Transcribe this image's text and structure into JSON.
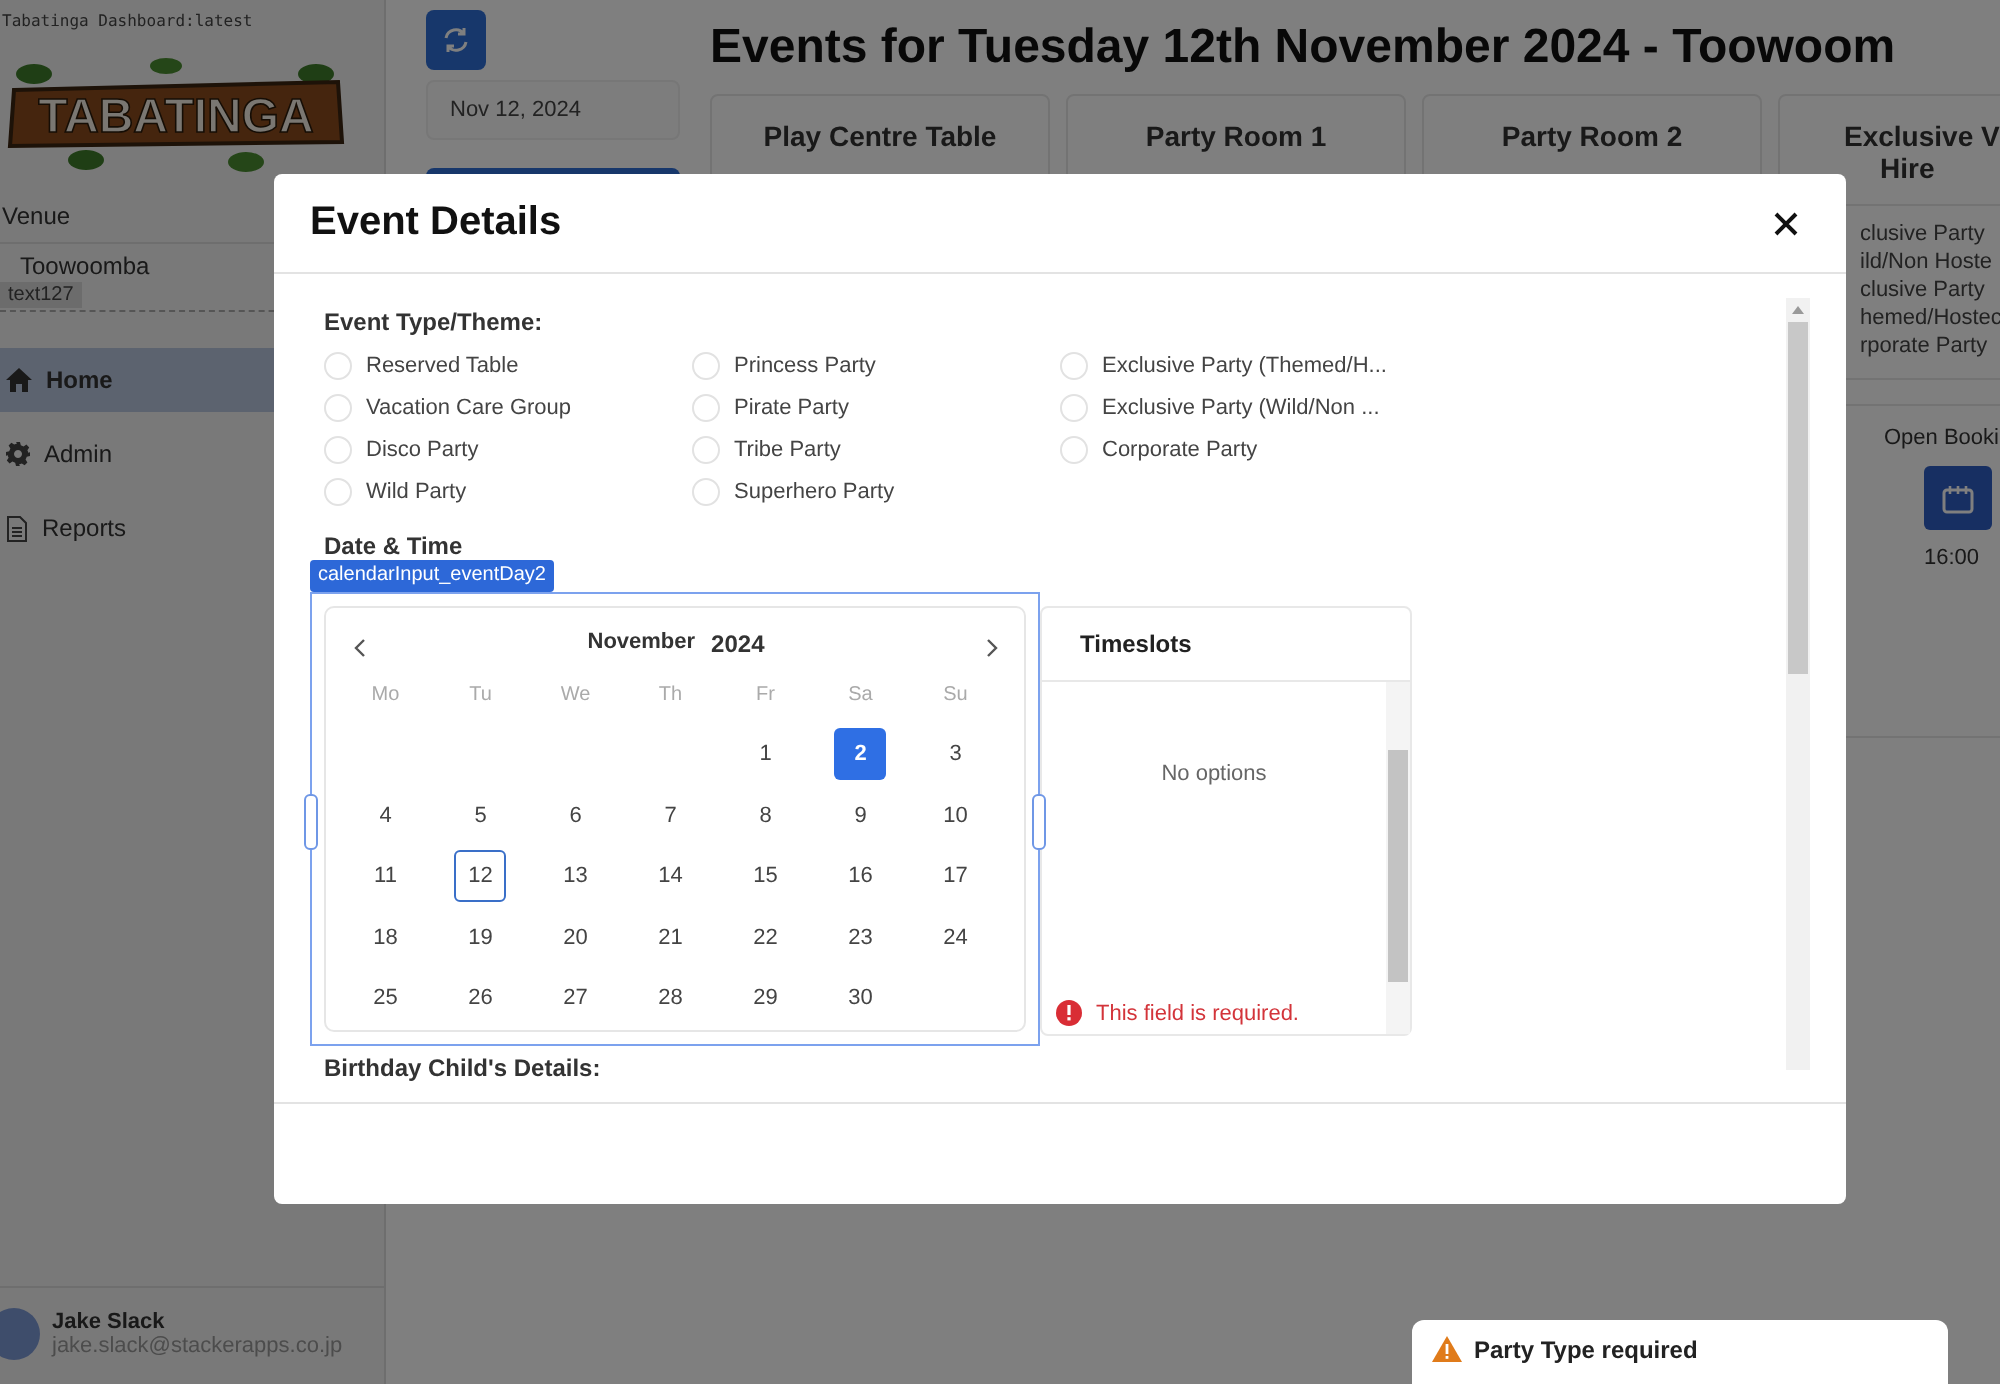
{
  "build_label": "Tabatinga Dashboard:latest",
  "sidebar": {
    "logo_text": "TABATINGA",
    "venue_label": "Venue",
    "venue_value": "Toowoomba",
    "debug_tag": "text127",
    "nav": [
      {
        "label": "Home",
        "kind": "home",
        "selected": true
      },
      {
        "label": "Admin",
        "kind": "gear",
        "selected": false
      },
      {
        "label": "Reports",
        "kind": "document",
        "selected": false
      }
    ],
    "user": {
      "name": "Jake Slack",
      "email": "jake.slack@stackerapps.co.jp"
    }
  },
  "toolbar": {
    "date": "Nov 12, 2024"
  },
  "page_title": "Events for Tuesday 12th November 2024 - Toowoom",
  "columns": [
    {
      "title_lines": [
        "Play Centre Table"
      ]
    },
    {
      "title_lines": [
        "Party Room 1"
      ]
    },
    {
      "title_lines": [
        "Party Room 2"
      ]
    },
    {
      "title_lines": [
        "Exclusive V",
        "Hire"
      ],
      "items": [
        "clusive Party",
        "ild/Non Hoste",
        "clusive Party",
        "hemed/Hostec",
        "rporate Party"
      ],
      "open_label": "Open Booki",
      "time": "16:00"
    }
  ],
  "modal": {
    "title": "Event Details",
    "event_type": {
      "label": "Event Type/Theme:",
      "options": [
        {
          "label": "Reserved Table",
          "selected": false
        },
        {
          "label": "Vacation Care Group",
          "selected": false
        },
        {
          "label": "Disco Party",
          "selected": false
        },
        {
          "label": "Wild Party",
          "selected": false
        },
        {
          "label": "Princess Party",
          "selected": false
        },
        {
          "label": "Pirate Party",
          "selected": false
        },
        {
          "label": "Tribe Party",
          "selected": false
        },
        {
          "label": "Superhero Party",
          "selected": false
        },
        {
          "label": "Exclusive Party (Themed/H...",
          "selected": false
        },
        {
          "label": "Exclusive Party (Wild/Non ...",
          "selected": false
        },
        {
          "label": "Corporate Party",
          "selected": false
        }
      ]
    },
    "date_label": "Date & Time",
    "debug_tag": "calendarInput_eventDay2",
    "calendar": {
      "month": "November",
      "year": "2024",
      "weekdays": [
        "Mo",
        "Tu",
        "We",
        "Th",
        "Fr",
        "Sa",
        "Su"
      ],
      "weeks": [
        [
          {
            "kind": "blank"
          },
          {
            "kind": "blank"
          },
          {
            "kind": "blank"
          },
          {
            "kind": "blank"
          },
          {
            "kind": "day",
            "label": "1",
            "selected": false,
            "today": false
          },
          {
            "kind": "day",
            "label": "2",
            "selected": true,
            "today": false
          },
          {
            "kind": "day",
            "label": "3",
            "selected": false,
            "today": false
          }
        ],
        [
          {
            "kind": "day",
            "label": "4",
            "selected": false,
            "today": false
          },
          {
            "kind": "day",
            "label": "5",
            "selected": false,
            "today": false
          },
          {
            "kind": "day",
            "label": "6",
            "selected": false,
            "today": false
          },
          {
            "kind": "day",
            "label": "7",
            "selected": false,
            "today": false
          },
          {
            "kind": "day",
            "label": "8",
            "selected": false,
            "today": false
          },
          {
            "kind": "day",
            "label": "9",
            "selected": false,
            "today": false
          },
          {
            "kind": "day",
            "label": "10",
            "selected": false,
            "today": false
          }
        ],
        [
          {
            "kind": "day",
            "label": "11",
            "selected": false,
            "today": false
          },
          {
            "kind": "day",
            "label": "12",
            "selected": false,
            "today": true
          },
          {
            "kind": "day",
            "label": "13",
            "selected": false,
            "today": false
          },
          {
            "kind": "day",
            "label": "14",
            "selected": false,
            "today": false
          },
          {
            "kind": "day",
            "label": "15",
            "selected": false,
            "today": false
          },
          {
            "kind": "day",
            "label": "16",
            "selected": false,
            "today": false
          },
          {
            "kind": "day",
            "label": "17",
            "selected": false,
            "today": false
          }
        ],
        [
          {
            "kind": "day",
            "label": "18",
            "selected": false,
            "today": false
          },
          {
            "kind": "day",
            "label": "19",
            "selected": false,
            "today": false
          },
          {
            "kind": "day",
            "label": "20",
            "selected": false,
            "today": false
          },
          {
            "kind": "day",
            "label": "21",
            "selected": false,
            "today": false
          },
          {
            "kind": "day",
            "label": "22",
            "selected": false,
            "today": false
          },
          {
            "kind": "day",
            "label": "23",
            "selected": false,
            "today": false
          },
          {
            "kind": "day",
            "label": "24",
            "selected": false,
            "today": false
          }
        ],
        [
          {
            "kind": "day",
            "label": "25",
            "selected": false,
            "today": false
          },
          {
            "kind": "day",
            "label": "26",
            "selected": false,
            "today": false
          },
          {
            "kind": "day",
            "label": "27",
            "selected": false,
            "today": false
          },
          {
            "kind": "day",
            "label": "28",
            "selected": false,
            "today": false
          },
          {
            "kind": "day",
            "label": "29",
            "selected": false,
            "today": false
          },
          {
            "kind": "day",
            "label": "30",
            "selected": false,
            "today": false
          },
          {
            "kind": "blank"
          }
        ]
      ]
    },
    "timeslots": {
      "title": "Timeslots",
      "empty_text": "No options",
      "error": "This field is required."
    },
    "next_section": "Birthday Child's Details:"
  },
  "toast": {
    "title": "Party Type required"
  }
}
